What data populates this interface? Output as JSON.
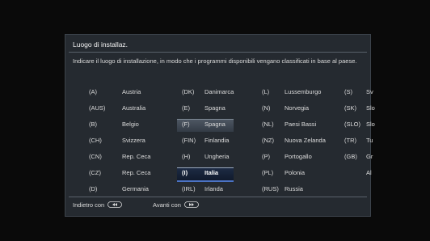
{
  "dialog": {
    "title": "Luogo di installaz.",
    "description": "Indicare il luogo di installazione, in modo che i programmi disponibili vengano classificati in base al paese."
  },
  "countries": [
    {
      "code": "(A)",
      "name": "Austria"
    },
    {
      "code": "(AUS)",
      "name": "Australia"
    },
    {
      "code": "(B)",
      "name": "Belgio"
    },
    {
      "code": "(CH)",
      "name": "Svizzera"
    },
    {
      "code": "(CN)",
      "name": "Rep. Ceca"
    },
    {
      "code": "(CZ)",
      "name": "Rep. Ceca"
    },
    {
      "code": "(D)",
      "name": "Germania"
    },
    {
      "code": "(DK)",
      "name": "Danimarca"
    },
    {
      "code": "(E)",
      "name": "Spagna"
    },
    {
      "code": "(F)",
      "name": "Spagna"
    },
    {
      "code": "(FIN)",
      "name": "Finlandia"
    },
    {
      "code": "(H)",
      "name": "Ungheria"
    },
    {
      "code": "(I)",
      "name": "Italia"
    },
    {
      "code": "(IRL)",
      "name": "Irlanda"
    },
    {
      "code": "(L)",
      "name": "Lussemburgo"
    },
    {
      "code": "(N)",
      "name": "Norvegia"
    },
    {
      "code": "(NL)",
      "name": "Paesi Bassi"
    },
    {
      "code": "(NZ)",
      "name": "Nuova Zelanda"
    },
    {
      "code": "(P)",
      "name": "Portogallo"
    },
    {
      "code": "(PL)",
      "name": "Polonia"
    },
    {
      "code": "(RUS)",
      "name": "Russia"
    },
    {
      "code": "(S)",
      "name": "Sv"
    },
    {
      "code": "(SK)",
      "name": "Slo"
    },
    {
      "code": "(SLO)",
      "name": "Slo"
    },
    {
      "code": "(TR)",
      "name": "Tu"
    },
    {
      "code": "(GB)",
      "name": "Gr"
    },
    {
      "code": "",
      "name": "Al"
    }
  ],
  "selected_index": 12,
  "hover_index": 9,
  "footer": {
    "back_label": "Indietro con",
    "next_label": "Avanti con"
  },
  "icons": {
    "back": "rewind-button-icon",
    "next": "fast-forward-button-icon"
  },
  "colors": {
    "selection_underline": "#4b73c4",
    "text": "#dcdcdc"
  }
}
